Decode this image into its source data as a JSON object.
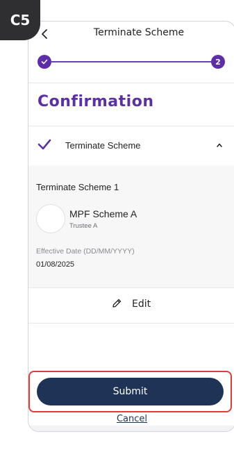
{
  "step_badge": "C5",
  "header": {
    "title": "Terminate Scheme",
    "back_icon": "chevron-left-icon"
  },
  "stepper": {
    "step1_icon": "check-icon",
    "step2_label": "2",
    "accent_color": "#5c2fa8"
  },
  "section": {
    "title": "Confirmation"
  },
  "accordion": {
    "label": "Terminate Scheme",
    "check_icon": "check-icon",
    "chevron_icon": "chevron-up-icon"
  },
  "detail": {
    "title": "Terminate Scheme 1",
    "scheme_name": "MPF Scheme A",
    "trustee": "Trustee A",
    "effective_date_label": "Effective Date (DD/MM/YYYY)",
    "effective_date_value": "01/08/2025"
  },
  "edit": {
    "label": "Edit",
    "icon": "pencil-icon"
  },
  "actions": {
    "submit_label": "Submit",
    "cancel_label": "Cancel",
    "submit_color": "#1e3355"
  },
  "highlight_color": "#e03a3a"
}
